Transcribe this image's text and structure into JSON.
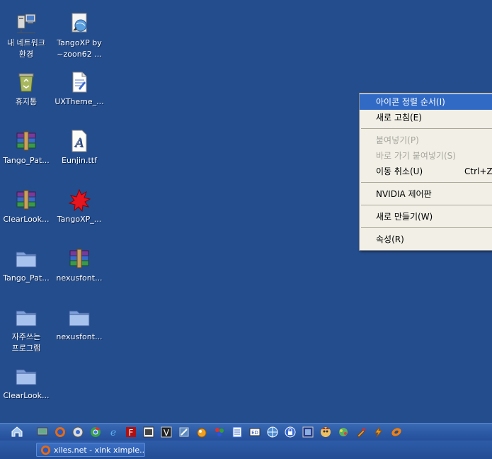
{
  "desktop": {
    "icons": [
      {
        "label": "내 네트워크\n환경",
        "icon": "network-places-icon"
      },
      {
        "label": "TangoXP by\n~zoon62 ...",
        "icon": "web-shortcut-icon"
      },
      {
        "label": "휴지통",
        "icon": "recycle-bin-icon"
      },
      {
        "label": "UXTheme_...",
        "icon": "document-icon"
      },
      {
        "label": "Tango_Pat...",
        "icon": "winrar-archive-icon"
      },
      {
        "label": "Eunjin.ttf",
        "icon": "font-file-icon"
      },
      {
        "label": "ClearLook...",
        "icon": "winrar-archive-icon"
      },
      {
        "label": "TangoXP_...",
        "icon": "red-splat-icon"
      },
      {
        "label": "Tango_Pat...",
        "icon": "folder-icon"
      },
      {
        "label": "nexusfont...",
        "icon": "winrar-archive-icon"
      },
      {
        "label": "자주쓰는\n프로그램",
        "icon": "folder-icon"
      },
      {
        "label": "nexusfont...",
        "icon": "folder-icon"
      },
      {
        "label": "ClearLook...",
        "icon": "folder-icon"
      }
    ]
  },
  "context_menu": {
    "items": [
      {
        "label": "아이콘 정렬 순서(I)",
        "state": "selected"
      },
      {
        "label": "새로 고침(E)",
        "state": "normal"
      },
      {
        "label": "붙여넣기(P)",
        "state": "disabled"
      },
      {
        "label": "바로 가기 붙여넣기(S)",
        "state": "disabled"
      },
      {
        "label": "이동 취소(U)",
        "state": "normal",
        "shortcut": "Ctrl+Z"
      },
      {
        "label": "NVIDIA 제어판",
        "state": "normal"
      },
      {
        "label": "새로 만들기(W)",
        "state": "normal"
      },
      {
        "label": "속성(R)",
        "state": "normal"
      }
    ]
  },
  "taskbar": {
    "task_button_label": "xiles.net - xink ximple...",
    "quick_launch": [
      "show-desktop-icon",
      "monitor-icon",
      "firefox-icon",
      "media-icon",
      "chrome-icon",
      "ie-icon",
      "filezilla-icon",
      "vnc-icon",
      "v-app-icon",
      "tool-icon",
      "ball-icon",
      "paint-icon",
      "notepad-icon",
      "app-icon",
      "globe-icon",
      "lock-icon",
      "blue-app-icon",
      "anime-icon",
      "game-icon",
      "tool2-icon",
      "lightning-icon",
      "orange-icon"
    ]
  },
  "colors": {
    "desktop": "#244d8d",
    "menu_bg": "#f1efe6",
    "menu_highlight": "#316ac5"
  }
}
